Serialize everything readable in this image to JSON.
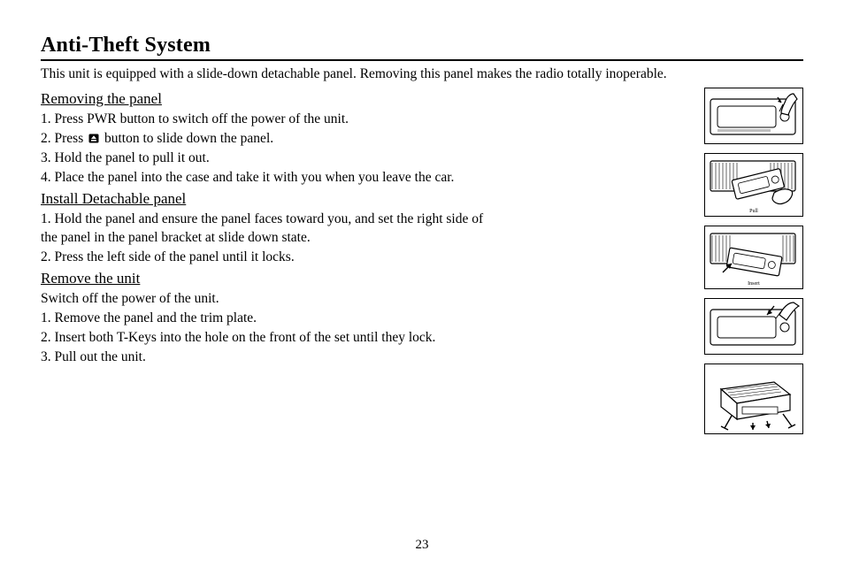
{
  "title": "Anti-Theft System",
  "intro": "This unit is equipped with a slide-down detachable panel. Removing this panel makes the radio totally inoperable.",
  "sections": {
    "removing": {
      "heading": "Removing the panel ",
      "steps": [
        "1.  Press PWR button to switch off the power of the unit.",
        "2.  Press ",
        " button to slide down the panel.",
        "3.  Hold the panel to pull it out.",
        "4.  Place the panel into the case and take it with you when you leave the car."
      ]
    },
    "install": {
      "heading": "Install Detachable panel",
      "lines": [
        "1.  Hold the panel and ensure the panel faces toward you, and set the right side of",
        "the panel in the panel bracket at slide down state.",
        "2.  Press the left side of the panel until it locks."
      ]
    },
    "removeunit": {
      "heading": "Remove the unit",
      "lines": [
        "Switch off the power of the unit.",
        "1. Remove the panel and the trim plate.",
        "2. Insert both T-Keys into the hole on the front of the set until they lock.",
        "3. Pull out the unit."
      ]
    }
  },
  "figures": {
    "fig2_caption": "Pull",
    "fig3_caption": "Insert"
  },
  "page_number": "23"
}
